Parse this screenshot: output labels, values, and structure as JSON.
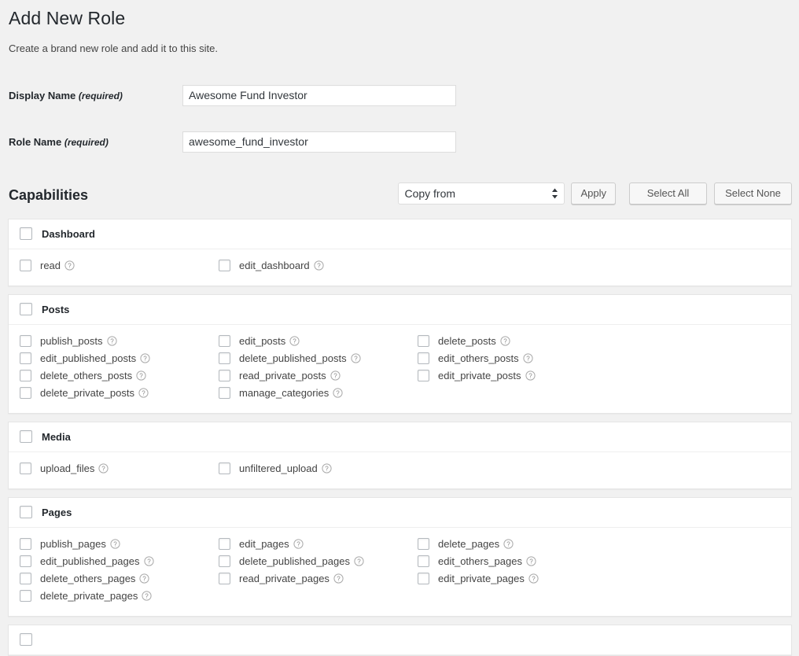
{
  "page": {
    "title": "Add New Role",
    "description": "Create a brand new role and add it to this site."
  },
  "form": {
    "display_name": {
      "label": "Display Name",
      "required_note": "(required)",
      "value": "Awesome Fund Investor",
      "placeholder": ""
    },
    "role_name": {
      "label": "Role Name",
      "required_note": "(required)",
      "value": "awesome_fund_investor",
      "placeholder": ""
    }
  },
  "capabilities_bar": {
    "heading": "Capabilities",
    "copy_from": {
      "selected": "Copy from",
      "options": [
        "Copy from"
      ],
      "icon": "updown-arrows-icon"
    },
    "apply_label": "Apply",
    "select_all_label": "Select All",
    "select_none_label": "Select None"
  },
  "help_icon_glyph": "?",
  "sections": [
    {
      "title": "Dashboard",
      "caps": [
        "read",
        "edit_dashboard"
      ]
    },
    {
      "title": "Posts",
      "caps": [
        "publish_posts",
        "edit_posts",
        "delete_posts",
        "edit_published_posts",
        "delete_published_posts",
        "edit_others_posts",
        "delete_others_posts",
        "read_private_posts",
        "edit_private_posts",
        "delete_private_posts",
        "manage_categories"
      ]
    },
    {
      "title": "Media",
      "caps": [
        "upload_files",
        "unfiltered_upload"
      ]
    },
    {
      "title": "Pages",
      "caps": [
        "publish_pages",
        "edit_pages",
        "delete_pages",
        "edit_published_pages",
        "delete_published_pages",
        "edit_others_pages",
        "delete_others_pages",
        "read_private_pages",
        "edit_private_pages",
        "delete_private_pages"
      ]
    },
    {
      "title": "",
      "caps": []
    }
  ],
  "colors": {
    "background": "#f1f1f1",
    "panel": "#ffffff",
    "border": "#e5e5e5",
    "text": "#444444",
    "heading": "#23282d",
    "button_face": "#f7f7f7"
  }
}
